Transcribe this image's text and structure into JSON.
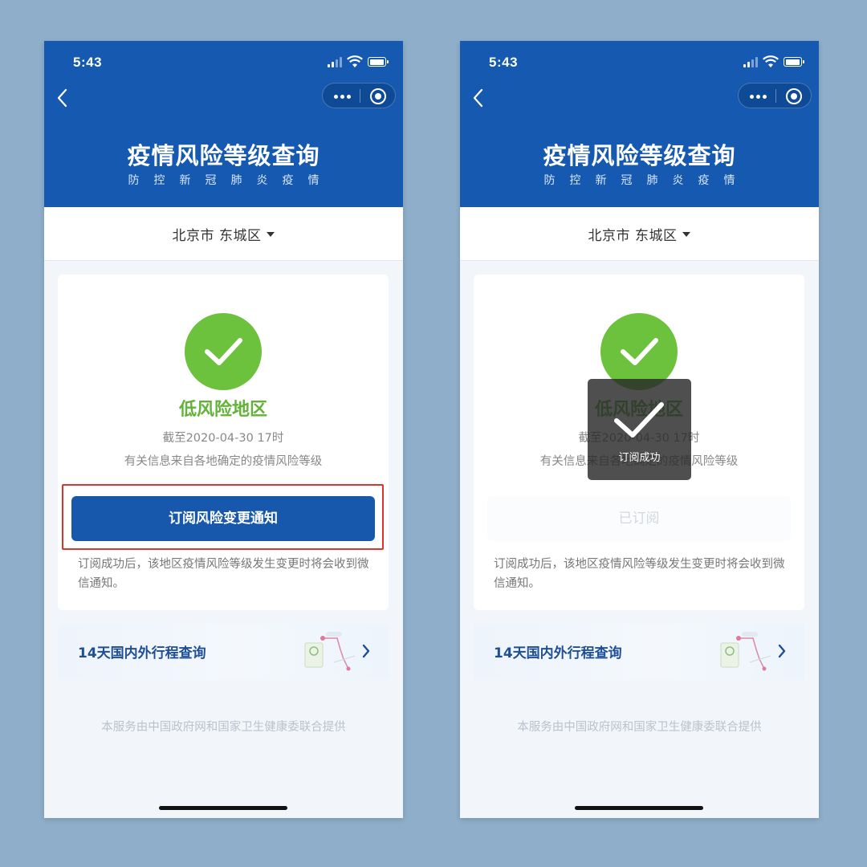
{
  "phones": [
    {
      "status": {
        "time": "5:43"
      },
      "header": {
        "title": "疫情风险等级查询",
        "subtitle": "防控新冠肺炎疫情"
      },
      "location": "北京市 东城区",
      "card": {
        "risk_level": "低风险地区",
        "as_of": "截至2020-04-30 17时",
        "info_note": "有关信息来自各地确定的疫情风险等级",
        "button_label": "订阅风险变更通知",
        "description": "订阅成功后，该地区疫情风险等级发生变更时将会收到微信通知。"
      },
      "trip_banner": {
        "title": "14天国内外行程查询"
      },
      "footer": "本服务由中国政府网和国家卫生健康委联合提供"
    },
    {
      "status": {
        "time": "5:43"
      },
      "header": {
        "title": "疫情风险等级查询",
        "subtitle": "防控新冠肺炎疫情"
      },
      "location": "北京市 东城区",
      "card": {
        "risk_level": "低风险地区",
        "as_of": "截至2020-04-30 17时",
        "info_note": "有关信息来自各地确定的疫情风险等级",
        "button_label": "已订阅",
        "description": "订阅成功后，该地区疫情风险等级发生变更时将会收到微信通知。"
      },
      "toast": {
        "text": "订阅成功"
      },
      "trip_banner": {
        "title": "14天国内外行程查询"
      },
      "footer": "本服务由中国政府网和国家卫生健康委联合提供"
    }
  ],
  "colors": {
    "background": "#8eaec9",
    "header_blue": "#1659b0",
    "button_blue": "#1758ac",
    "success_green": "#6cc23c",
    "risk_text_green": "#62b23a",
    "highlight_red": "#d8362c"
  },
  "icons": [
    "back-icon",
    "more-icon",
    "target-icon",
    "check-icon",
    "chevron-down-icon",
    "chevron-right-icon",
    "map-route-icon"
  ]
}
